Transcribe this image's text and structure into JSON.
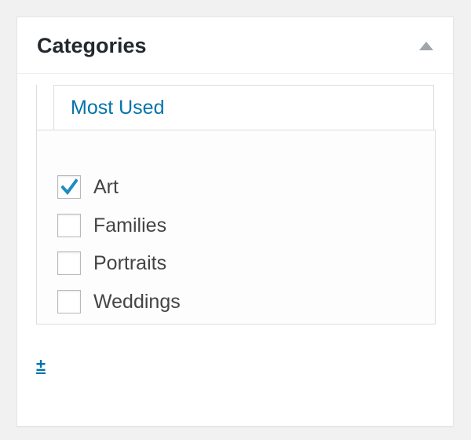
{
  "metabox": {
    "title": "Categories",
    "toggle_icon": "triangle-up-icon"
  },
  "tabs": [
    {
      "label": "Most Used",
      "active": true
    }
  ],
  "categories": [
    {
      "label": "Art",
      "checked": true
    },
    {
      "label": "Families",
      "checked": false
    },
    {
      "label": "Portraits",
      "checked": false
    },
    {
      "label": "Weddings",
      "checked": false
    }
  ],
  "add_link": {
    "label": "±"
  },
  "colors": {
    "accent": "#0073aa",
    "text": "#444444",
    "title": "#23282d",
    "border": "#dddddd",
    "background": "#f1f1f1"
  }
}
